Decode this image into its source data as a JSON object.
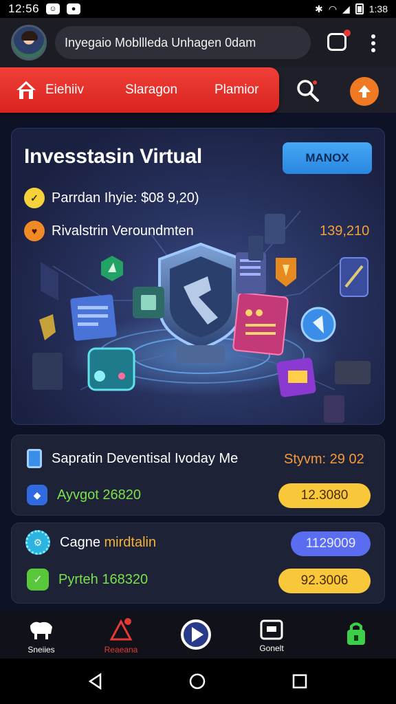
{
  "status_bar": {
    "time": "12:56",
    "right_time": "1:38"
  },
  "app_bar": {
    "search_text": "Inyegaio Mobllleda Unhagen 0dam"
  },
  "nav": {
    "tabs": [
      "Eiehiiv",
      "Slaragon",
      "Plamior"
    ]
  },
  "hero": {
    "title": "Invesstasin Virtual",
    "button_label": "MANOX",
    "line1": "Parrdan Ihyie: $08 9,20)",
    "line2": "Rivalstrin Veroundmten",
    "amount": "139,210"
  },
  "card1": {
    "title": "Sapratin Deventisal Ivoday Me",
    "stat": "Styvm: 29 02",
    "sub_label": "Ayvgot 26820",
    "pill": "12.3080"
  },
  "card2": {
    "row1_label_prefix": "Cagne",
    "row1_label_accent": "mirdtalin",
    "row1_pill": "1129009",
    "row2_label": "Pyrteh 168320",
    "row2_pill": "92.3006"
  },
  "bottom_nav": {
    "items": [
      {
        "label": "Sneiies",
        "color": "#ffffff"
      },
      {
        "label": "Reaeana",
        "color": "#e53935"
      },
      {
        "label": "",
        "color": "#ffffff"
      },
      {
        "label": "Gonelt",
        "color": "#ffffff"
      },
      {
        "label": "",
        "color": "#3ecf4a"
      }
    ]
  },
  "colors": {
    "accent_red": "#e5322c",
    "accent_blue": "#3a94ec",
    "accent_yellow": "#f9c53a",
    "accent_purple": "#5a6cf0"
  }
}
